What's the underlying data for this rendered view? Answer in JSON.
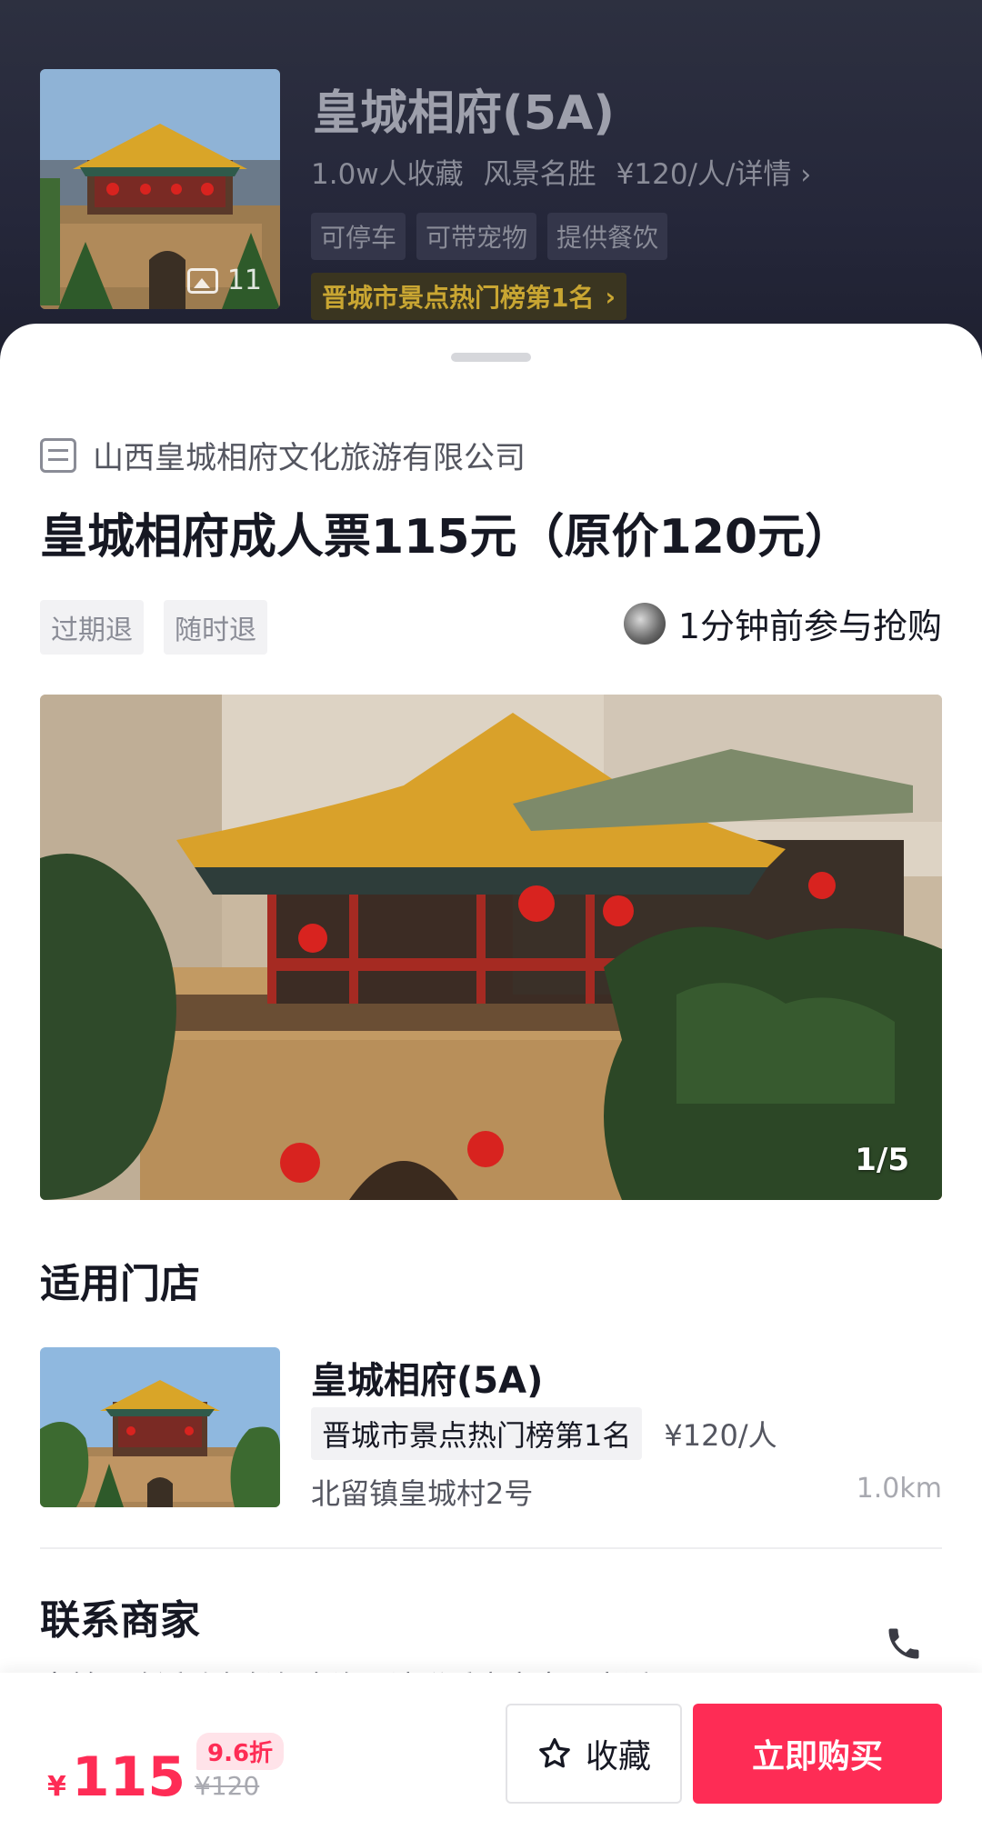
{
  "poi": {
    "title": "皇城相府(5A)",
    "favorites": "1.0w人收藏",
    "category": "风景名胜",
    "price_detail": "¥120/人/详情",
    "tags": [
      "可停车",
      "可带宠物",
      "提供餐饮"
    ],
    "rank": "晋城市景点热门榜第1名",
    "image_count": "11"
  },
  "deal": {
    "merchant": "山西皇城相府文化旅游有限公司",
    "title": "皇城相府成人票115元（原价120元）",
    "refund_tags": [
      "过期退",
      "随时退"
    ],
    "recent_activity": "1分钟前参与抢购",
    "photo_index": "1/5"
  },
  "stores": {
    "section_title": "适用门店",
    "name": "皇城相府(5A)",
    "rank": "晋城市景点热门榜第1名",
    "price": "¥120/人",
    "address": "北留镇皇城村2号",
    "distance": "1.0km"
  },
  "contact": {
    "section_title": "联系商家",
    "description": "当前团购活动有任何咨询，请联系商家客服电话"
  },
  "bottom_bar": {
    "currency": "¥",
    "price": "115",
    "discount": "9.6折",
    "original_price": "¥120",
    "favorite_label": "收藏",
    "buy_label": "立即购买"
  },
  "colors": {
    "accent": "#fe2c55",
    "rank_gold": "#c9a632",
    "header_bg": "#25273a"
  }
}
